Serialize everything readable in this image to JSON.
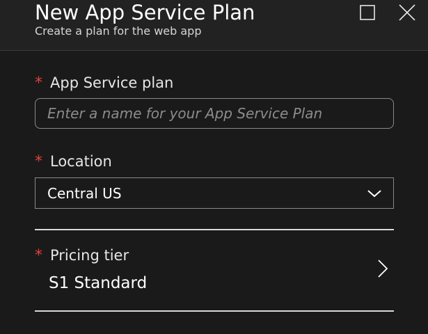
{
  "header": {
    "title": "New App Service Plan",
    "subtitle": "Create a plan for the web app"
  },
  "form": {
    "required_marker": "*",
    "app_service_plan": {
      "label": "App Service plan",
      "value": "",
      "placeholder": "Enter a name for your App Service Plan"
    },
    "location": {
      "label": "Location",
      "selected": "Central US"
    },
    "pricing_tier": {
      "label": "Pricing tier",
      "value": "S1 Standard"
    }
  },
  "colors": {
    "background": "#1a1a1a",
    "header_background": "#222222",
    "required": "#e0433b",
    "text": "#ffffff",
    "placeholder": "#8c8c8c",
    "border": "#8a8a8a"
  },
  "icons": {
    "maximize": "maximize-icon",
    "close": "close-icon",
    "dropdown": "chevron-down-icon",
    "navigate": "chevron-right-icon"
  }
}
